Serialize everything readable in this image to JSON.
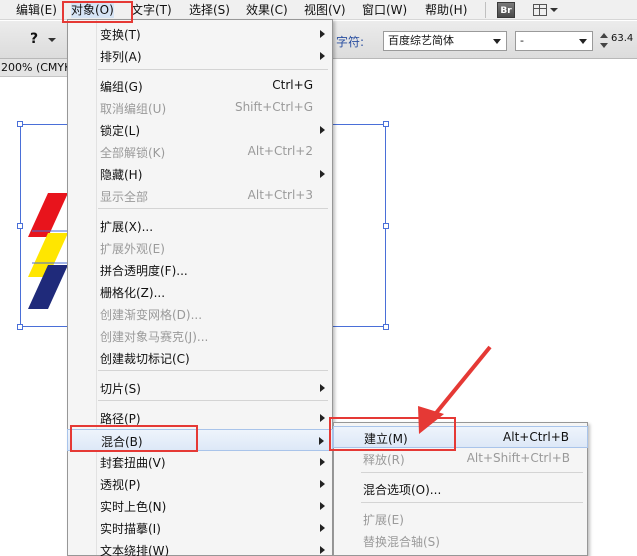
{
  "menubar": {
    "items": [
      {
        "label": "编辑(E)"
      },
      {
        "label": "对象(O)"
      },
      {
        "label": "文字(T)"
      },
      {
        "label": "选择(S)"
      },
      {
        "label": "效果(C)"
      },
      {
        "label": "视图(V)"
      },
      {
        "label": "窗口(W)"
      },
      {
        "label": "帮助(H)"
      }
    ],
    "bridge_label": "Br"
  },
  "controlbar": {
    "help_label": "?",
    "font_label": "字符:",
    "font_family": "百度综艺简体",
    "font_style": "-",
    "font_size": "63.4"
  },
  "document": {
    "tab_label": "200% (CMYK"
  },
  "object_menu": {
    "items": [
      {
        "label": "变换(T)",
        "shortcut": "",
        "submenu": true,
        "disabled": false
      },
      {
        "label": "排列(A)",
        "shortcut": "",
        "submenu": true,
        "disabled": false
      },
      {
        "label": "编组(G)",
        "shortcut": "Ctrl+G",
        "submenu": false,
        "disabled": false
      },
      {
        "label": "取消编组(U)",
        "shortcut": "Shift+Ctrl+G",
        "submenu": false,
        "disabled": true
      },
      {
        "label": "锁定(L)",
        "shortcut": "",
        "submenu": true,
        "disabled": false
      },
      {
        "label": "全部解锁(K)",
        "shortcut": "Alt+Ctrl+2",
        "submenu": false,
        "disabled": true
      },
      {
        "label": "隐藏(H)",
        "shortcut": "",
        "submenu": true,
        "disabled": false
      },
      {
        "label": "显示全部",
        "shortcut": "Alt+Ctrl+3",
        "submenu": false,
        "disabled": true
      },
      {
        "label": "扩展(X)...",
        "shortcut": "",
        "submenu": false,
        "disabled": false
      },
      {
        "label": "扩展外观(E)",
        "shortcut": "",
        "submenu": false,
        "disabled": true
      },
      {
        "label": "拼合透明度(F)...",
        "shortcut": "",
        "submenu": false,
        "disabled": false
      },
      {
        "label": "栅格化(Z)...",
        "shortcut": "",
        "submenu": false,
        "disabled": false
      },
      {
        "label": "创建渐变网格(D)...",
        "shortcut": "",
        "submenu": false,
        "disabled": true
      },
      {
        "label": "创建对象马赛克(J)...",
        "shortcut": "",
        "submenu": false,
        "disabled": true
      },
      {
        "label": "创建裁切标记(C)",
        "shortcut": "",
        "submenu": false,
        "disabled": false
      },
      {
        "label": "切片(S)",
        "shortcut": "",
        "submenu": true,
        "disabled": false
      },
      {
        "label": "路径(P)",
        "shortcut": "",
        "submenu": true,
        "disabled": false
      },
      {
        "label": "混合(B)",
        "shortcut": "",
        "submenu": true,
        "disabled": false
      },
      {
        "label": "封套扭曲(V)",
        "shortcut": "",
        "submenu": true,
        "disabled": false
      },
      {
        "label": "透视(P)",
        "shortcut": "",
        "submenu": true,
        "disabled": false
      },
      {
        "label": "实时上色(N)",
        "shortcut": "",
        "submenu": true,
        "disabled": false
      },
      {
        "label": "实时描摹(I)",
        "shortcut": "",
        "submenu": true,
        "disabled": false
      },
      {
        "label": "文本绕排(W)",
        "shortcut": "",
        "submenu": true,
        "disabled": false
      }
    ]
  },
  "blend_submenu": {
    "items": [
      {
        "label": "建立(M)",
        "shortcut": "Alt+Ctrl+B",
        "disabled": false
      },
      {
        "label": "释放(R)",
        "shortcut": "Alt+Shift+Ctrl+B",
        "disabled": true
      },
      {
        "label": "混合选项(O)...",
        "shortcut": "",
        "disabled": false
      },
      {
        "label": "扩展(E)",
        "shortcut": "",
        "disabled": true
      },
      {
        "label": "替换混合轴(S)",
        "shortcut": "",
        "disabled": true
      }
    ]
  },
  "colors": {
    "annotation_red": "#e53935",
    "selection_blue": "#4a6fd8",
    "art_red": "#e8141c",
    "art_yellow": "#ffe600",
    "art_navy": "#1f2a7a"
  }
}
